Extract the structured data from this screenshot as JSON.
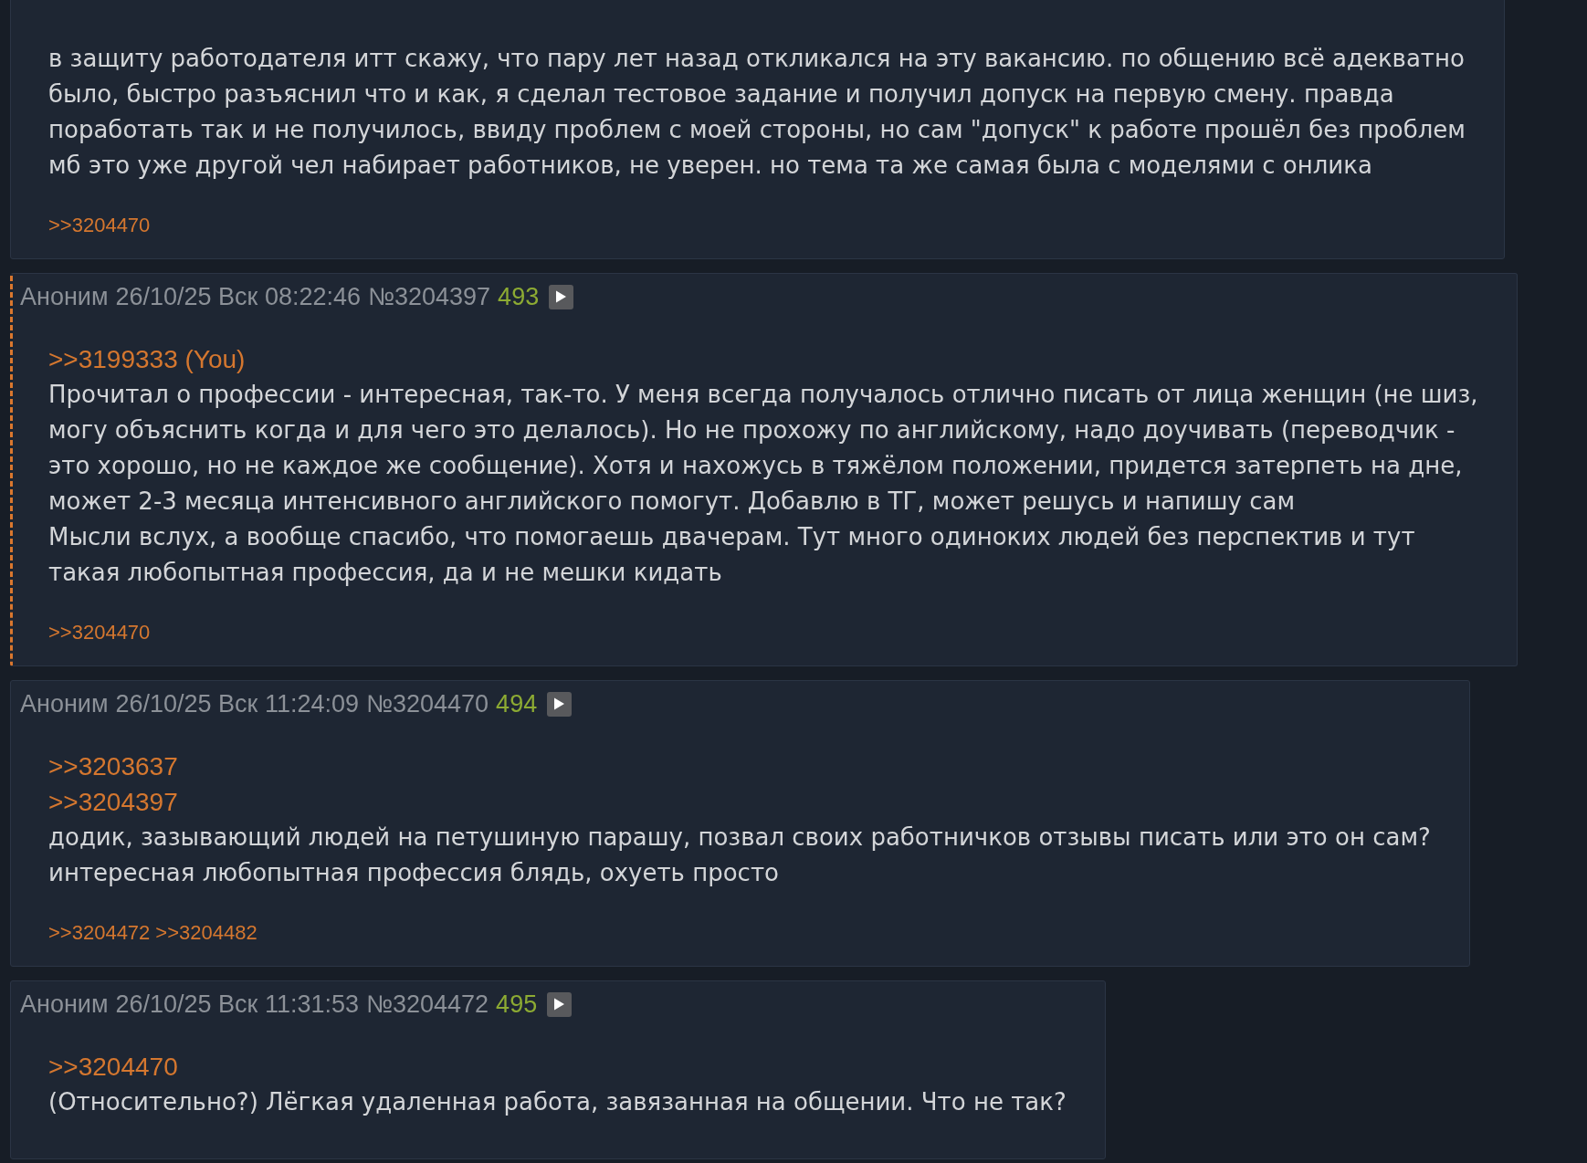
{
  "posts": [
    {
      "highlighted": false,
      "lines": [
        "в защиту работодателя итт скажу, что пару лет назад откликался на эту вакансию. по общению всё адекватно",
        "было, быстро разъяснил что и как, я сделал тестовое задание и получил допуск на первую смену. правда",
        "поработать так и не получилось, ввиду проблем с моей стороны, но сам \"допуск\" к работе прошёл без проблем",
        "мб это уже другой чел набирает работников, не уверен. но тема та же самая была с моделями с онлика"
      ],
      "replies": [
        ">>3204470"
      ]
    },
    {
      "author": "Аноним",
      "datetime": "26/10/25 Вск 08:22:46",
      "number": "№3204397",
      "count": "493",
      "highlighted": true,
      "quotes": [
        ">>3199333 (You)"
      ],
      "lines": [
        "Прочитал о профессии - интересная, так-то. У меня всегда получалось отлично писать от лица женщин (не шиз,",
        "могу объяснить когда и для чего это делалось). Но не прохожу по английскому, надо доучивать (переводчик -",
        "это хорошо, но не каждое же сообщение). Хотя и нахожусь в тяжёлом положении, придется затерпеть на дне,",
        "может 2-3 месяца интенсивного английского помогут. Добавлю в ТГ, может решусь и напишу сам",
        "Мысли вслух, а вообще спасибо, что помогаешь двачерам. Тут много одиноких людей без перспектив и тут",
        "такая любопытная профессия, да и не мешки кидать"
      ],
      "replies": [
        ">>3204470"
      ]
    },
    {
      "author": "Аноним",
      "datetime": "26/10/25 Вск 11:24:09",
      "number": "№3204470",
      "count": "494",
      "highlighted": false,
      "quotes": [
        ">>3203637",
        ">>3204397"
      ],
      "lines": [
        "додик, зазывающий людей на петушиную парашу, позвал своих работничков отзывы писать или это он сам?",
        "интересная любопытная профессия блядь, охуеть просто"
      ],
      "replies": [
        ">>3204472",
        ">>3204482"
      ]
    },
    {
      "author": "Аноним",
      "datetime": "26/10/25 Вск 11:31:53",
      "number": "№3204472",
      "count": "495",
      "highlighted": false,
      "quotes": [
        ">>3204470"
      ],
      "lines": [
        "(Относительно?) Лёгкая удаленная работа, завязанная на общении. Что не так?"
      ]
    }
  ]
}
